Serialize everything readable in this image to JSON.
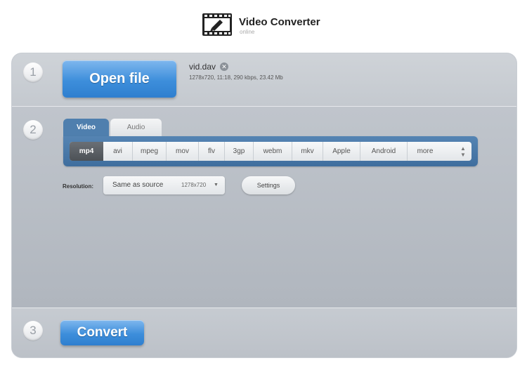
{
  "header": {
    "title": "Video Converter",
    "subtitle": "online",
    "logo_icon": "film-edit-icon"
  },
  "step1": {
    "number": "1",
    "open_button": "Open file",
    "file_name": "vid.dav",
    "file_info": "1278x720, 11:18, 290 kbps, 23.42 Mb",
    "remove_icon": "close-icon"
  },
  "step2": {
    "number": "2",
    "tabs": [
      "Video",
      "Audio"
    ],
    "formats": [
      "mp4",
      "avi",
      "mpeg",
      "mov",
      "flv",
      "3gp",
      "webm",
      "mkv",
      "Apple",
      "Android",
      "more"
    ],
    "active_format": "mp4",
    "resolution_label": "Resolution:",
    "resolution_value": "Same as source",
    "resolution_dim": "1278x720",
    "settings_label": "Settings"
  },
  "step3": {
    "number": "3",
    "convert_button": "Convert"
  },
  "colors": {
    "accent_blue": "#3d8edb",
    "tab_blue": "#4f7fae",
    "panel": "#b3b9c1"
  }
}
